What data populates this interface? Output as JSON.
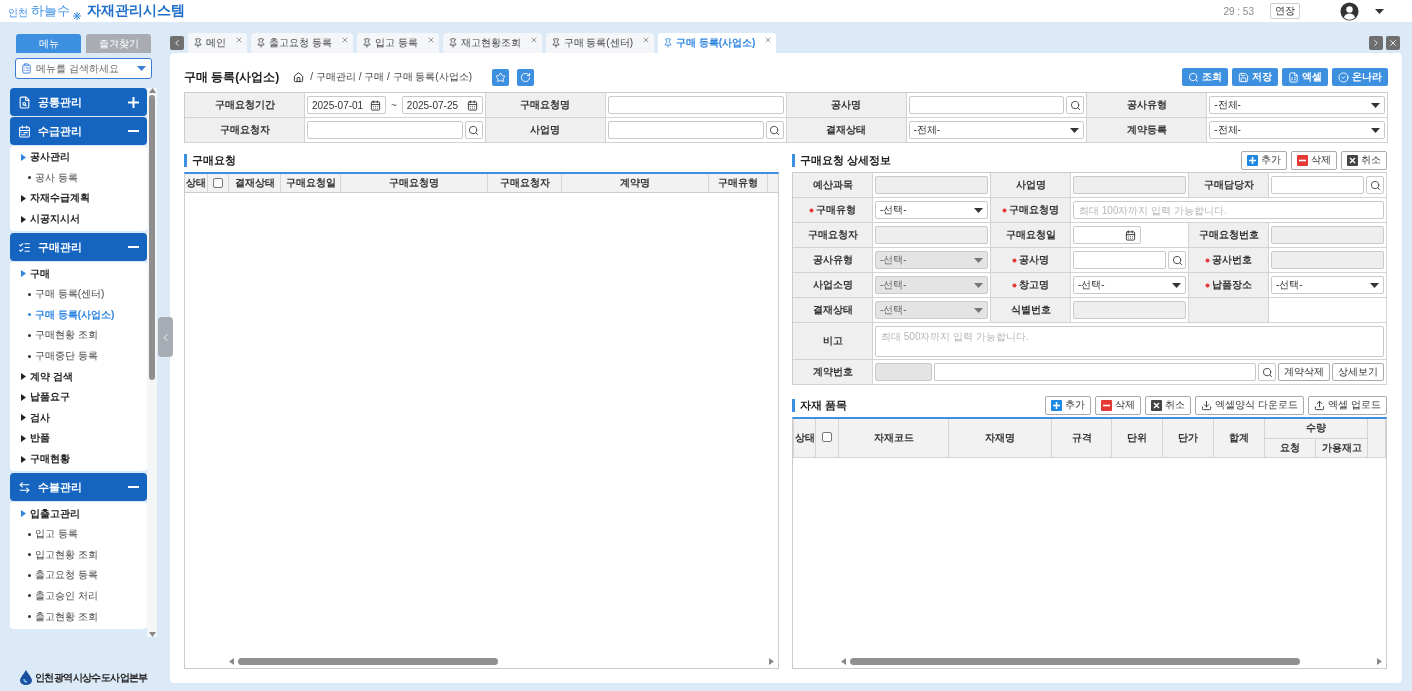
{
  "header": {
    "logo": {
      "region": "인천",
      "name": "하늘수"
    },
    "title": "자재관리시스템",
    "timer": "29 : 53",
    "extend_button": "연장"
  },
  "sidebar": {
    "tabs": [
      {
        "label": "메뉴",
        "selected": true
      },
      {
        "label": "즐겨찾기",
        "selected": false
      }
    ],
    "search": {
      "placeholder": "메뉴를 검색하세요"
    },
    "groups": [
      {
        "label": "공통관리",
        "expanded": false
      },
      {
        "label": "수급관리",
        "expanded": true,
        "children": [
          {
            "kind": "folder",
            "label": "공사관리",
            "expanded": true,
            "children": [
              {
                "kind": "page",
                "label": "공사 등록",
                "selected": false
              }
            ]
          },
          {
            "kind": "folder",
            "label": "자재수급계획",
            "expanded": false
          },
          {
            "kind": "folder",
            "label": "시공지시서",
            "expanded": false
          }
        ]
      },
      {
        "label": "구매관리",
        "expanded": true,
        "children": [
          {
            "kind": "folder",
            "label": "구매",
            "expanded": true,
            "children": [
              {
                "kind": "page",
                "label": "구매 등록(센터)",
                "selected": false
              },
              {
                "kind": "page",
                "label": "구매 등록(사업소)",
                "selected": true
              },
              {
                "kind": "page",
                "label": "구매현황 조회",
                "selected": false
              },
              {
                "kind": "page",
                "label": "구매중단 등록",
                "selected": false
              }
            ]
          },
          {
            "kind": "folder",
            "label": "계약 검색",
            "expanded": false
          },
          {
            "kind": "folder",
            "label": "납품요구",
            "expanded": false
          },
          {
            "kind": "folder",
            "label": "검사",
            "expanded": false
          },
          {
            "kind": "folder",
            "label": "반품",
            "expanded": false
          },
          {
            "kind": "folder",
            "label": "구매현황",
            "expanded": false
          }
        ]
      },
      {
        "label": "수불관리",
        "expanded": true,
        "children": [
          {
            "kind": "folder",
            "label": "입출고관리",
            "expanded": true,
            "children": [
              {
                "kind": "page",
                "label": "입고 등록",
                "selected": false
              },
              {
                "kind": "page",
                "label": "입고현황 조회",
                "selected": false
              },
              {
                "kind": "page",
                "label": "출고요청 등록",
                "selected": false
              },
              {
                "kind": "page",
                "label": "출고승인 처리",
                "selected": false
              },
              {
                "kind": "page",
                "label": "출고현황 조회",
                "selected": false
              }
            ]
          }
        ]
      }
    ],
    "footer": "인천광역시상수도사업본부"
  },
  "tabs": [
    {
      "label": "메인",
      "selected": false
    },
    {
      "label": "출고요청 등록",
      "selected": false
    },
    {
      "label": "입고 등록",
      "selected": false
    },
    {
      "label": "재고현황조회",
      "selected": false
    },
    {
      "label": "구매 등록(센터)",
      "selected": false
    },
    {
      "label": "구매 등록(사업소)",
      "selected": true
    }
  ],
  "page": {
    "title": "구매 등록(사업소)",
    "breadcrumb": "/ 구매관리 / 구매 / 구매 등록(사업소)",
    "actions": [
      {
        "kind": "search",
        "label": "조회"
      },
      {
        "kind": "save",
        "label": "저장"
      },
      {
        "kind": "excel",
        "label": "엑셀"
      },
      {
        "kind": "approve",
        "label": "온나라"
      }
    ]
  },
  "search_form": {
    "fields": [
      {
        "label": "구매요청기간",
        "field": {
          "kind": "daterange",
          "from": "2025-07-01",
          "separator": "~",
          "to": "2025-07-25"
        }
      },
      {
        "label": "구매요청명",
        "field": {
          "kind": "text"
        }
      },
      {
        "label": "공사명",
        "field": {
          "kind": "search"
        }
      },
      {
        "label": "공사유형",
        "field": {
          "kind": "select",
          "value": "-전체-"
        }
      },
      {
        "label": "구매요청자",
        "field": {
          "kind": "search"
        }
      },
      {
        "label": "사업명",
        "field": {
          "kind": "search"
        }
      },
      {
        "label": "결재상태",
        "field": {
          "kind": "select",
          "value": "-전체-"
        }
      },
      {
        "label": "계약등록",
        "field": {
          "kind": "select",
          "value": "-전체-"
        }
      }
    ]
  },
  "request_list": {
    "title": "구매요청",
    "columns": [
      {
        "kind": "text",
        "label": "상태"
      },
      {
        "kind": "checkbox",
        "checked": false
      },
      {
        "kind": "text",
        "label": "결재상태"
      },
      {
        "kind": "text",
        "label": "구매요청일"
      },
      {
        "kind": "text",
        "label": "구매요청명"
      },
      {
        "kind": "text",
        "label": "구매요청자"
      },
      {
        "kind": "text",
        "label": "계약명"
      },
      {
        "kind": "text",
        "label": "구매유형"
      }
    ]
  },
  "detail": {
    "title": "구매요청 상세정보",
    "buttons": [
      {
        "kind": "add",
        "label": "추가"
      },
      {
        "kind": "delete",
        "label": "삭제"
      },
      {
        "kind": "cancel",
        "label": "취소"
      }
    ],
    "rows": [
      {
        "cells": [
          {
            "label": "예산과목",
            "required": false,
            "field": {
              "kind": "text",
              "disabled": true
            }
          },
          {
            "label": "사업명",
            "required": false,
            "field": {
              "kind": "text",
              "disabled": true
            }
          },
          {
            "label": "구매담당자",
            "required": false,
            "field": {
              "kind": "search",
              "disabled": false
            }
          }
        ]
      },
      {
        "cells": [
          {
            "label": "구매유형",
            "required": true,
            "field": {
              "kind": "select",
              "value": "-선택-",
              "disabled": false
            }
          },
          {
            "label": "구매요청명",
            "required": true,
            "field": {
              "kind": "text",
              "placeholder": "최대 100자까지 입력 가능합니다.",
              "disabled": false
            }
          }
        ]
      },
      {
        "cells": [
          {
            "label": "구매요청자",
            "required": false,
            "field": {
              "kind": "text",
              "disabled": true
            }
          },
          {
            "label": "구매요청일",
            "required": false,
            "field": {
              "kind": "date",
              "disabled": false
            }
          },
          {
            "label": "구매요청번호",
            "required": false,
            "field": {
              "kind": "text",
              "disabled": true
            }
          }
        ]
      },
      {
        "cells": [
          {
            "label": "공사유형",
            "required": false,
            "field": {
              "kind": "select",
              "value": "-선택-",
              "disabled": true
            }
          },
          {
            "label": "공사명",
            "required": true,
            "field": {
              "kind": "search",
              "disabled": false
            }
          },
          {
            "label": "공사번호",
            "required": true,
            "field": {
              "kind": "text",
              "disabled": true
            }
          }
        ]
      },
      {
        "cells": [
          {
            "label": "사업소명",
            "required": false,
            "field": {
              "kind": "select",
              "value": "-선택-",
              "disabled": true
            }
          },
          {
            "label": "창고명",
            "required": true,
            "field": {
              "kind": "select",
              "value": "-선택-",
              "disabled": false
            }
          },
          {
            "label": "납품장소",
            "required": true,
            "field": {
              "kind": "select",
              "value": "-선택-",
              "disabled": false
            }
          }
        ]
      },
      {
        "cells": [
          {
            "label": "결재상태",
            "required": false,
            "field": {
              "kind": "select",
              "value": "-선택-",
              "disabled": true
            }
          },
          {
            "label": "식별번호",
            "required": false,
            "field": {
              "kind": "text",
              "disabled": true
            }
          },
          {
            "kind": "blank"
          }
        ]
      },
      {
        "cells": [
          {
            "label": "비고",
            "required": false,
            "field": {
              "kind": "textarea",
              "placeholder": "최대 500자까지 입력 가능합니다.",
              "disabled": false
            }
          }
        ]
      },
      {
        "cells": [
          {
            "label": "계약번호",
            "required": false,
            "field": {
              "kind": "contract",
              "disabled": false,
              "buttons": [
                "계약삭제",
                "상세보기"
              ]
            }
          }
        ]
      }
    ]
  },
  "materials": {
    "title": "자재 품목",
    "buttons": [
      {
        "kind": "add",
        "label": "추가"
      },
      {
        "kind": "delete",
        "label": "삭제"
      },
      {
        "kind": "cancel",
        "label": "취소"
      },
      {
        "kind": "download",
        "label": "엑셀양식 다운로드"
      },
      {
        "kind": "upload",
        "label": "엑셀 업로드"
      }
    ],
    "columns": [
      {
        "kind": "text",
        "label": "상태"
      },
      {
        "kind": "checkbox",
        "checked": false
      },
      {
        "kind": "text",
        "label": "자재코드"
      },
      {
        "kind": "text",
        "label": "자재명"
      },
      {
        "kind": "text",
        "label": "규격"
      },
      {
        "kind": "text",
        "label": "단위"
      },
      {
        "kind": "text",
        "label": "단가"
      },
      {
        "kind": "text",
        "label": "합계"
      },
      {
        "kind": "group",
        "label": "수량",
        "children": [
          {
            "label": "요청"
          },
          {
            "label": "가용재고"
          }
        ]
      }
    ]
  }
}
